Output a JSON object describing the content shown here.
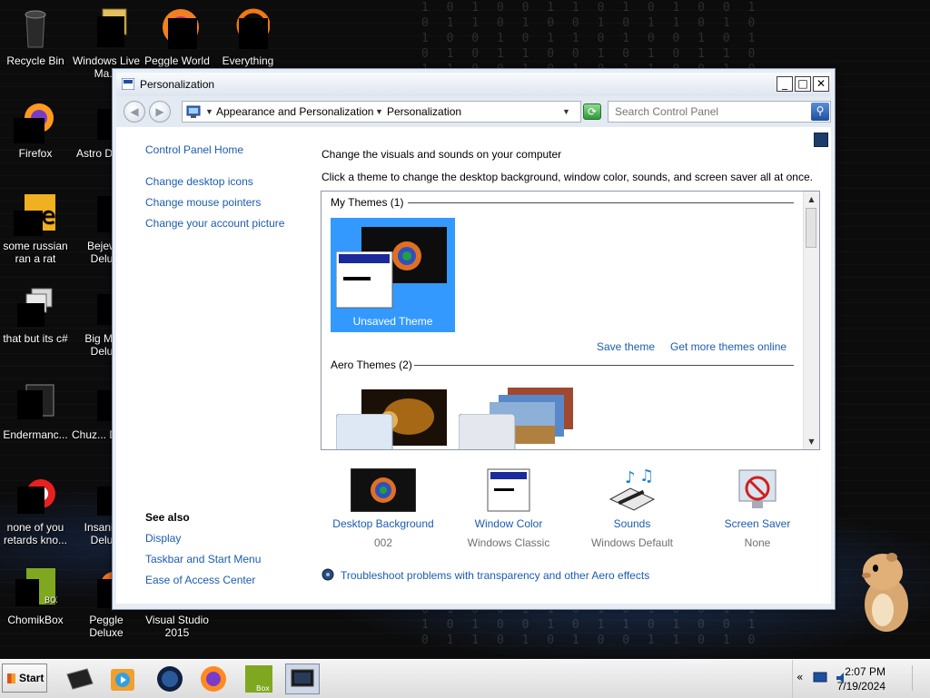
{
  "desktop": {
    "icons": [
      {
        "label": "Recycle Bin"
      },
      {
        "label": "Windows Live Ma..."
      },
      {
        "label": "Peggle World"
      },
      {
        "label": "Everything"
      },
      {
        "label": "Firefox"
      },
      {
        "label": "Astro Delu..."
      },
      {
        "label": "some russian ran a rat"
      },
      {
        "label": "Bejew... Delu..."
      },
      {
        "label": "that but its c#"
      },
      {
        "label": "Big Mo... Delu..."
      },
      {
        "label": "Endermanc..."
      },
      {
        "label": "Chuz... Delu..."
      },
      {
        "label": "none of you retards kno..."
      },
      {
        "label": "Insaniq... Delu..."
      },
      {
        "label": "ChomikBox"
      },
      {
        "label": "Peggle Deluxe"
      },
      {
        "label": "Visual Studio 2015"
      }
    ]
  },
  "window": {
    "title": "Personalization",
    "controls": {
      "minimize": "_",
      "maximize": "□",
      "close": "✕"
    },
    "address": {
      "segments": [
        "Appearance and Personalization",
        "Personalization"
      ]
    },
    "search": {
      "placeholder": "Search Control Panel"
    },
    "left_pane": {
      "home_link": "Control Panel Home",
      "links": [
        "Change desktop icons",
        "Change mouse pointers",
        "Change your account picture"
      ],
      "see_also_heading": "See also",
      "see_also_links": [
        "Display",
        "Taskbar and Start Menu",
        "Ease of Access Center"
      ]
    },
    "main": {
      "heading": "Change the visuals and sounds on your computer",
      "description": "Click a theme to change the desktop background, window color, sounds, and screen saver all at once.",
      "groups": [
        {
          "header": "My Themes (1)",
          "themes": [
            {
              "name": "Unsaved Theme",
              "selected": true
            }
          ]
        },
        {
          "header": "Aero Themes (2)",
          "themes": [
            {
              "name": ""
            },
            {
              "name": ""
            }
          ]
        }
      ],
      "save_theme_link": "Save theme",
      "more_themes_link": "Get more themes online",
      "bottom_items": [
        {
          "label": "Desktop Background",
          "value": "002",
          "icon": "desktop-background-icon"
        },
        {
          "label": "Window Color",
          "value": "Windows Classic",
          "icon": "window-color-icon"
        },
        {
          "label": "Sounds",
          "value": "Windows Default",
          "icon": "sounds-icon"
        },
        {
          "label": "Screen Saver",
          "value": "None",
          "icon": "screen-saver-icon"
        }
      ],
      "troubleshoot_link": "Troubleshoot problems with transparency and other Aero effects"
    }
  },
  "taskbar": {
    "start_label": "Start",
    "clock": {
      "time": "2:07 PM",
      "date": "7/19/2024"
    },
    "tray_expand": "«"
  },
  "colors": {
    "selection": "#3399ff",
    "link": "#1b5cb0",
    "window_frame": "#e9edf3"
  }
}
